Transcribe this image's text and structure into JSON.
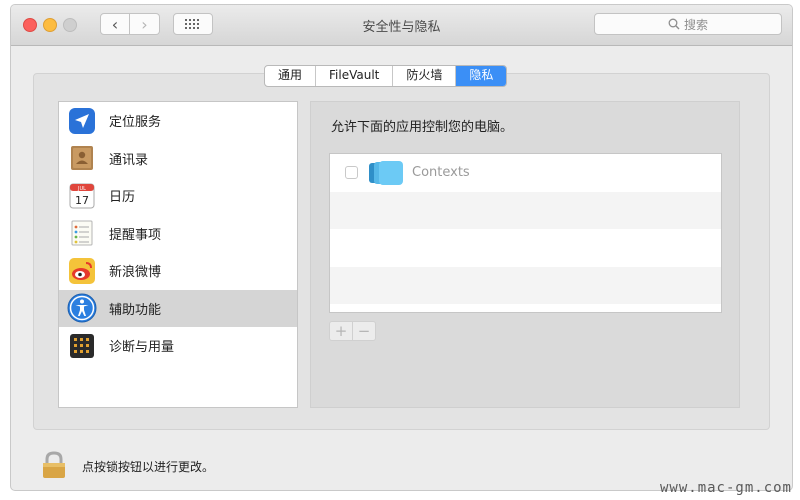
{
  "window": {
    "title": "安全性与隐私",
    "nav_back": "‹",
    "nav_forward": "›"
  },
  "search": {
    "placeholder": "搜索"
  },
  "tabs": [
    {
      "label": "通用"
    },
    {
      "label": "FileVault"
    },
    {
      "label": "防火墙"
    },
    {
      "label": "隐私",
      "active": true
    }
  ],
  "sidebar": {
    "items": [
      {
        "label": "定位服务",
        "icon": "location-arrow-icon"
      },
      {
        "label": "通讯录",
        "icon": "contacts-book-icon"
      },
      {
        "label": "日历",
        "icon": "calendar-icon",
        "icon_text": "17",
        "icon_month": "JUL"
      },
      {
        "label": "提醒事项",
        "icon": "reminders-icon"
      },
      {
        "label": "新浪微博",
        "icon": "weibo-icon"
      },
      {
        "label": "辅助功能",
        "icon": "accessibility-icon",
        "selected": true
      },
      {
        "label": "诊断与用量",
        "icon": "diagnostics-icon"
      }
    ]
  },
  "panel": {
    "heading": "允许下面的应用控制您的电脑。",
    "apps": [
      {
        "name": "Contexts",
        "checked": false
      }
    ],
    "add_label": "+",
    "remove_label": "−"
  },
  "footer": {
    "lock_text": "点按锁按钮以进行更改。"
  },
  "watermark": "www.mac-gm.com",
  "colors": {
    "accent": "#3b8ff6",
    "selected_row": "#d5d5d5"
  }
}
